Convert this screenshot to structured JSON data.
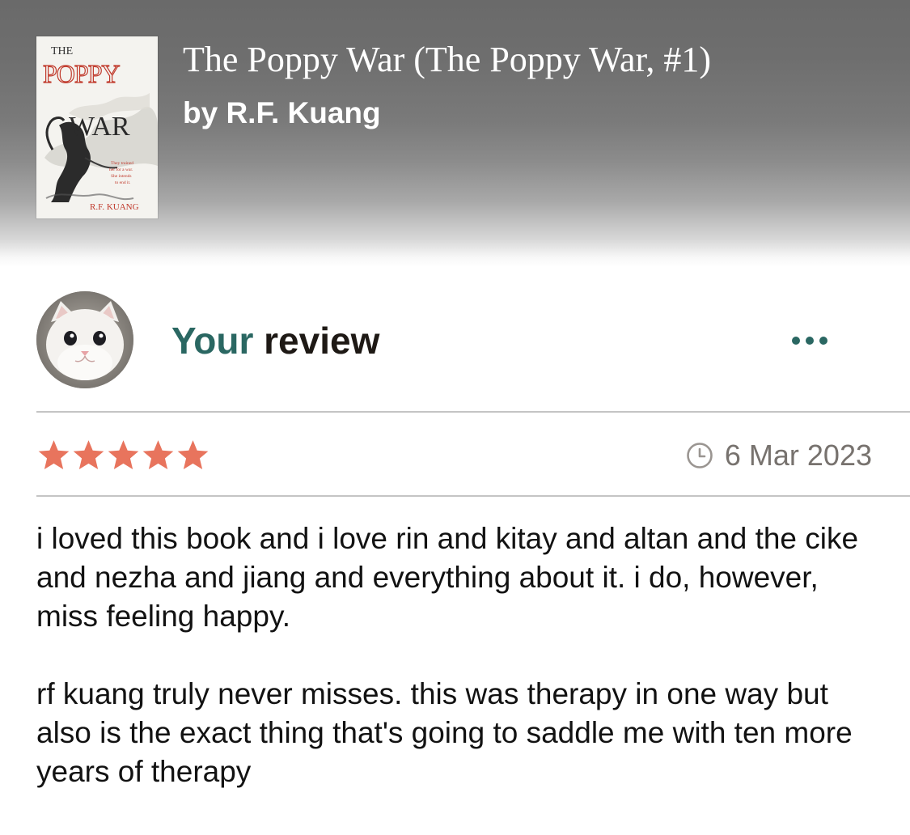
{
  "book": {
    "title": "The Poppy War (The Poppy War, #1)",
    "author_line": "by R.F. Kuang",
    "cover": {
      "top_word": "THE",
      "title_line1": "POPPY",
      "title_line2": "WAR",
      "tagline": "They trained her for a war. She intends to end it.",
      "author": "R.F. KUANG"
    }
  },
  "review_header": {
    "heading_highlight": "Your",
    "heading_rest": " review",
    "more_icon": "more-horizontal-icon",
    "avatar_icon": "user-avatar-white-kitten"
  },
  "rating": {
    "value": 5,
    "max": 5,
    "date_icon": "clock-icon",
    "date": "6 Mar 2023"
  },
  "review_text": {
    "paragraph1": "i loved this book and i love rin and kitay and altan and the cike and nezha and jiang and everything about it. i do, however, miss feeling happy.",
    "paragraph2": "rf kuang truly never misses. this was therapy in one way but also is the exact thing that's going to saddle me with ten more years of therapy"
  },
  "colors": {
    "accent_teal": "#2a6762",
    "star_orange": "#e8745d",
    "divider": "#c4c4c4",
    "date_gray": "#77726e",
    "cover_red": "#c0392b"
  }
}
